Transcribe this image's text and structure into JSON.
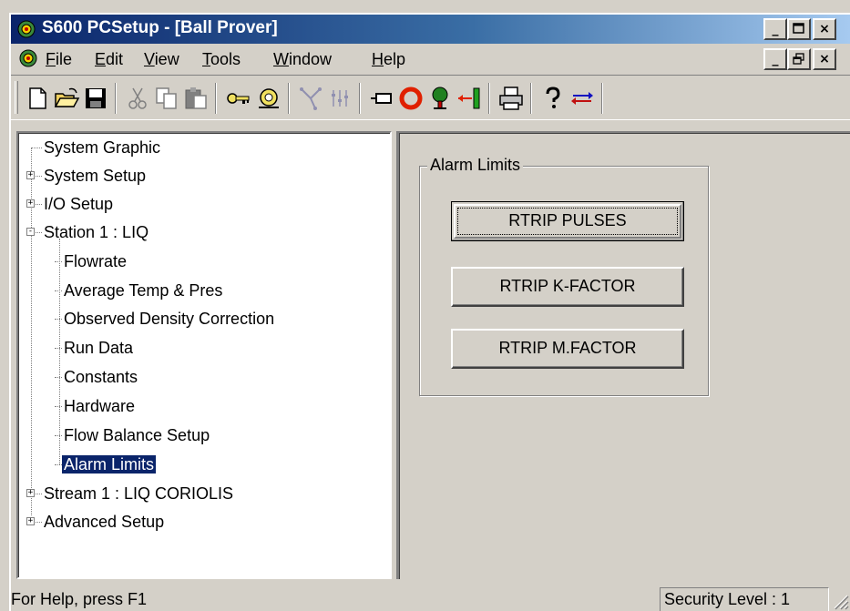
{
  "window": {
    "title": "S600 PCSetup - [Ball Prover]"
  },
  "caption_buttons": {
    "minimize": "_",
    "maximize": "□",
    "close": "×"
  },
  "menubar": {
    "items": [
      {
        "label": "File",
        "underline": "F",
        "rest": "ile"
      },
      {
        "label": "Edit",
        "underline": "E",
        "rest": "dit"
      },
      {
        "label": "View",
        "underline": "V",
        "rest": "iew"
      },
      {
        "label": "Tools",
        "underline": "T",
        "rest": "ools"
      },
      {
        "label": "Window",
        "underline": "W",
        "rest": "indow"
      },
      {
        "label": "Help",
        "underline": "H",
        "rest": "elp"
      }
    ],
    "mdi_buttons": {
      "minimize": "_",
      "restore": "❐",
      "close": "×"
    }
  },
  "toolbar": {
    "icons": [
      "new-icon",
      "open-icon",
      "save-icon",
      "cut-icon",
      "copy-icon",
      "paste-icon",
      "key-icon",
      "find-icon",
      "network-icon",
      "sliders-icon",
      "rectangle-icon",
      "ring-icon",
      "tree-icon",
      "arrow-bar-icon",
      "print-icon",
      "help-icon",
      "swap-arrows-icon"
    ]
  },
  "tree": {
    "items": [
      {
        "label": "System Graphic",
        "level": 0,
        "expander": ""
      },
      {
        "label": "System Setup",
        "level": 0,
        "expander": "+"
      },
      {
        "label": "I/O Setup",
        "level": 0,
        "expander": "+"
      },
      {
        "label": "Station 1 : LIQ",
        "level": 0,
        "expander": "-"
      },
      {
        "label": "Flowrate",
        "level": 1,
        "expander": ""
      },
      {
        "label": "Average Temp & Pres",
        "level": 1,
        "expander": ""
      },
      {
        "label": "Observed Density Correction",
        "level": 1,
        "expander": ""
      },
      {
        "label": "Run Data",
        "level": 1,
        "expander": ""
      },
      {
        "label": "Constants",
        "level": 1,
        "expander": ""
      },
      {
        "label": "Hardware",
        "level": 1,
        "expander": ""
      },
      {
        "label": "Flow Balance Setup",
        "level": 1,
        "expander": ""
      },
      {
        "label": "Alarm Limits",
        "level": 1,
        "expander": "",
        "selected": true
      },
      {
        "label": "Stream 1 : LIQ CORIOLIS",
        "level": 0,
        "expander": "+"
      },
      {
        "label": "Advanced Setup",
        "level": 0,
        "expander": "+"
      }
    ]
  },
  "alarm_limits": {
    "group_label": "Alarm Limits",
    "buttons": [
      "RTRIP PULSES",
      "RTRIP K-FACTOR",
      "RTRIP M.FACTOR"
    ]
  },
  "statusbar": {
    "help_text": "For Help, press F1",
    "security_level": "Security Level : 1"
  },
  "colors": {
    "title_start": "#0a246a",
    "title_end": "#a6caf0",
    "selection": "#0a246a",
    "face": "#d4d0c8"
  }
}
